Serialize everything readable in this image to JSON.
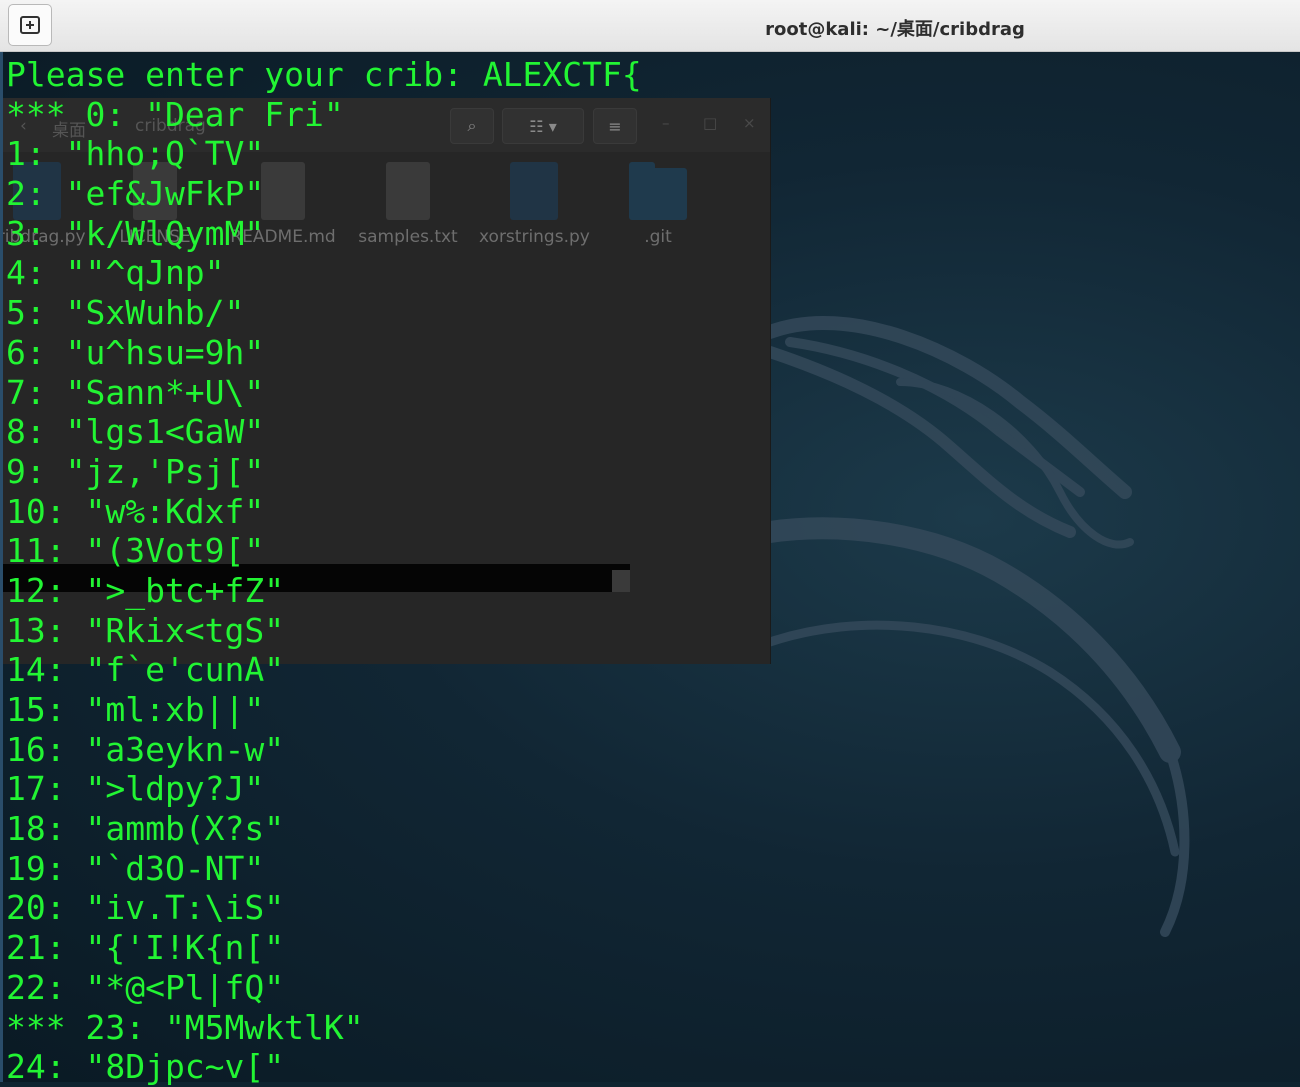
{
  "window": {
    "title": "root@kali: ~/桌面/cribdrag",
    "new_tab_icon": "new-tab-icon"
  },
  "file_manager": {
    "breadcrumb": [
      "root@kali: ~/桌面",
      "桌面",
      "cribdrag"
    ],
    "files": [
      {
        "name": "cribdrag.py",
        "icon": "python-file-icon"
      },
      {
        "name": "LICENSE",
        "icon": "document-icon"
      },
      {
        "name": "README.md",
        "icon": "document-icon"
      },
      {
        "name": "samples.txt",
        "icon": "document-icon"
      },
      {
        "name": "xorstrings.py",
        "icon": "python-file-icon"
      },
      {
        "name": ".git",
        "icon": "folder-icon"
      }
    ]
  },
  "terminal": {
    "lines": [
      "Please enter your crib: ALEXCTF{",
      "*** 0: \"Dear Fri\"",
      "1: \"hho;Q`TV\"",
      "2: \"ef&JwFkP\"",
      "3: \"k/WlQymM\"",
      "4: \"\"^qJnp\"",
      "5: \"SxWuhb/\"",
      "6: \"u^hsu=9h\"",
      "7: \"Sann*+U\\\"",
      "8: \"lgs1<GaW\"",
      "9: \"jz,'Psj[\"",
      "10: \"w%:Kdxf\"",
      "11: \"(3Vot9[\"",
      "12: \">_btc+fZ\"",
      "13: \"Rkix<tgS\"",
      "14: \"f`e'cunA\"",
      "15: \"ml:xb||\"",
      "16: \"a3eykn-w\"",
      "17: \">ldpy?J\"",
      "18: \"ammb(X?s\"",
      "19: \"`d3O-NT\"",
      "20: \"iv.T:\\iS\"",
      "21: \"{'I!K{n[\"",
      "22: \"*@<Pl|fQ\"",
      "*** 23: \"M5MwktlK\"",
      "24: \"8Djpc~v[\""
    ]
  },
  "colors": {
    "terminal_text": "#22f533",
    "desktop_bg": "#0f2430",
    "titlebar_bg": "#ececec"
  }
}
